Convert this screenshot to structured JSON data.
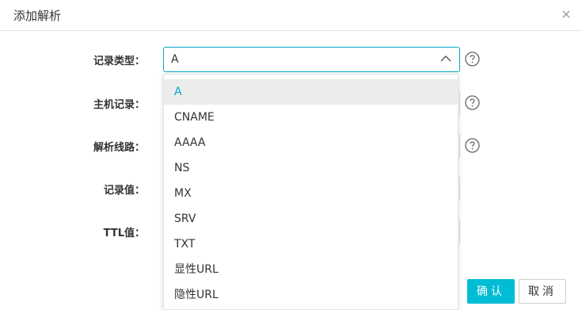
{
  "dialog": {
    "title": "添加解析",
    "close_icon": "close-icon"
  },
  "form": {
    "record_type": {
      "label": "记录类型：",
      "value": "A"
    },
    "host_record": {
      "label": "主机记录："
    },
    "line": {
      "label": "解析线路："
    },
    "record_value": {
      "label": "记录值："
    },
    "ttl": {
      "label": "TTL值："
    }
  },
  "dropdown": {
    "options": [
      "A",
      "CNAME",
      "AAAA",
      "NS",
      "MX",
      "SRV",
      "TXT",
      "显性URL",
      "隐性URL"
    ],
    "selected": "A"
  },
  "buttons": {
    "ok": "确认",
    "cancel": "取消"
  },
  "colors": {
    "accent": "#00a8c6",
    "ok_button": "#00bcd4"
  }
}
